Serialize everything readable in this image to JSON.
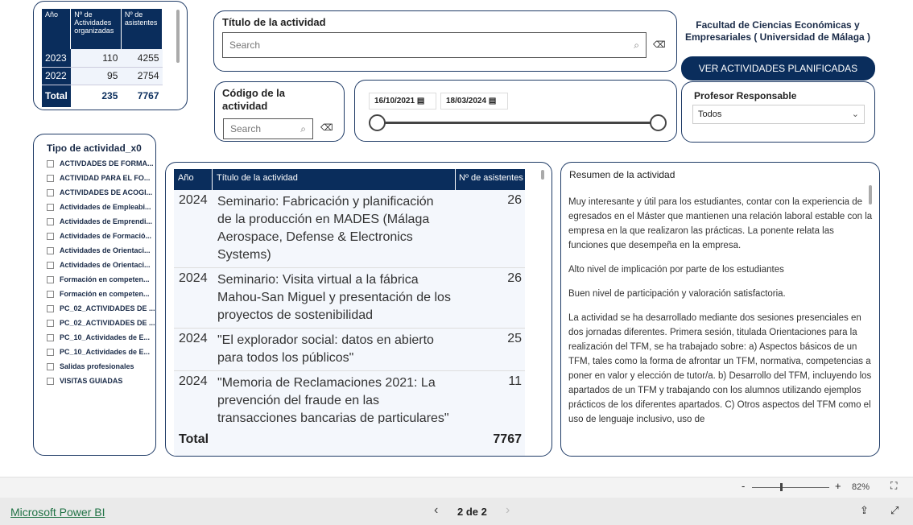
{
  "summary_table": {
    "headers": [
      "Año",
      "Nº de Actividades organizadas",
      "Nº de asistentes"
    ],
    "rows": [
      [
        "2023",
        "110",
        "4255"
      ],
      [
        "2022",
        "95",
        "2754"
      ]
    ],
    "total": [
      "Total",
      "235",
      "7767"
    ]
  },
  "tipo_filter": {
    "title": "Tipo de actividad_x0",
    "items": [
      "ACTIVDADES DE FORMA...",
      "ACTIVIDAD PARA EL FO...",
      "ACTIVIDADES DE ACOGI...",
      "Actividades de Empleabi...",
      "Actividades de Emprendi...",
      "Actividades de Formació...",
      "Actividades de Orientaci...",
      "Actividades de Orientaci...",
      "Formación en competen...",
      "Formación en competen...",
      "PC_02_ACTIVIDADES DE ...",
      "PC_02_ACTIVIDADES DE ...",
      "PC_10_Actividades de E...",
      "PC_10_Actividades de E...",
      "Salidas profesionales",
      "VISITAS GUIADAS"
    ]
  },
  "titulo_filter": {
    "label": "Título de la actividad",
    "placeholder": "Search"
  },
  "codigo_filter": {
    "label": "Código de la actividad",
    "placeholder": "Search"
  },
  "date_range": {
    "start": "16/10/2021",
    "end": "18/03/2024"
  },
  "header": {
    "title": "Facultad de Ciencias Económicas y Empresariales ( Universidad de Málaga )",
    "button": "VER ACTIVIDADES PLANIFICADAS"
  },
  "profesor": {
    "label": "Profesor Responsable",
    "value": "Todos"
  },
  "activity_table": {
    "headers": [
      "Año",
      "Título de la actividad",
      "Nº de asistentes"
    ],
    "rows": [
      {
        "year": "2024",
        "title": "Seminario: Fabricación y planificación de la producción en MADES (Málaga Aerospace, Defense & Electronics Systems)",
        "n": "26"
      },
      {
        "year": "2024",
        "title": "Seminario: Visita virtual a la fábrica Mahou-San Miguel y presentación de los proyectos de sostenibilidad",
        "n": "26"
      },
      {
        "year": "2024",
        "title": "\"El explorador social: datos en abierto para todos los públicos\"",
        "n": "25"
      },
      {
        "year": "2024",
        "title": "\"Memoria de Reclamaciones 2021: La prevención del fraude en las transacciones bancarias de particulares\"",
        "n": "11"
      }
    ],
    "total_label": "Total",
    "total": "7767"
  },
  "resumen": {
    "title": "Resumen de la actividad",
    "paragraphs": [
      "Muy interesante y útil para los estudiantes, contar con la experiencia de egresados en el Máster que mantienen una relación laboral estable con la empresa en la que realizaron las prácticas. La ponente relata las funciones que desempeña en la empresa.",
      "Alto nivel de implicación por parte de los estudiantes",
      "Buen nivel de participación y valoración satisfactoria.",
      "La actividad se ha desarrollado mediante dos sesiones presenciales en dos jornadas diferentes. Primera sesión, titulada Orientaciones para la realización del TFM, se ha trabajado sobre: a) Aspectos básicos de un TFM, tales como la forma de afrontar un TFM, normativa, competencias a poner en valor y elección de tutor/a. b) Desarrollo del TFM, incluyendo los apartados de un TFM y trabajando con los alumnos utilizando ejemplos prácticos de los diferentes apartados. C) Otros aspectos del TFM como el uso de lenguaje inclusivo, uso de"
    ]
  },
  "footer": {
    "zoom": "82%",
    "page": "2 de 2",
    "brand": "Microsoft Power BI"
  }
}
